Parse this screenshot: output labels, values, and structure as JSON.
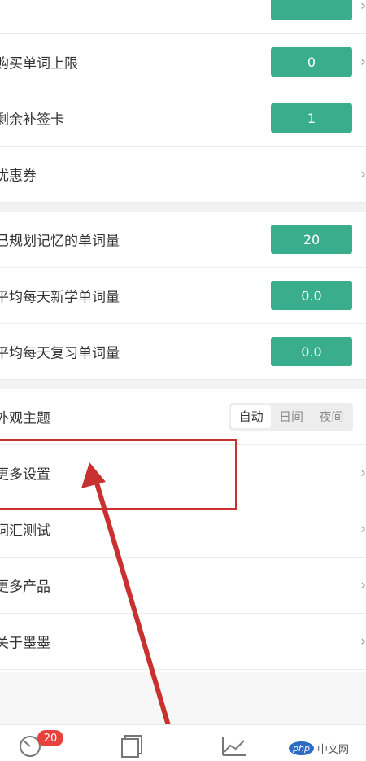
{
  "settings": {
    "top_partial_value": "",
    "purchase_limit": {
      "label": "购买单词上限",
      "value": "0"
    },
    "remaining_cards": {
      "label": "剩余补签卡",
      "value": "1"
    },
    "coupons": {
      "label": "优惠券"
    }
  },
  "stats": {
    "planned_words": {
      "label": "已规划记忆的单词量",
      "value": "20"
    },
    "avg_new": {
      "label": "平均每天新学单词量",
      "value": "0.0"
    },
    "avg_review": {
      "label": "平均每天复习单词量",
      "value": "0.0"
    }
  },
  "appearance": {
    "label": "外观主题",
    "options": [
      "自动",
      "日间",
      "夜间"
    ],
    "selected": "自动"
  },
  "menu": {
    "more_settings": "更多设置",
    "vocab_test": "词汇测试",
    "more_products": "更多产品",
    "about": "关于墨墨"
  },
  "tabbar": {
    "badge": "20"
  },
  "watermark": {
    "php": "php",
    "site": "中文网"
  },
  "colors": {
    "accent": "#3aae8c",
    "annotation": "#c8312f",
    "badge": "#e8413b"
  },
  "icons": [
    "chevron-right-icon",
    "clock-icon",
    "cards-icon",
    "chart-icon"
  ]
}
